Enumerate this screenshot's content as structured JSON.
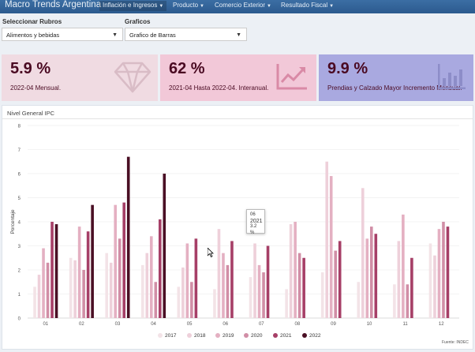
{
  "nav": {
    "brand": "Macro Trends Argentina",
    "items": [
      {
        "label": "Inflación e Ingresos"
      },
      {
        "label": "Producto"
      },
      {
        "label": "Comercio Exterior"
      },
      {
        "label": "Resultado Fiscal"
      }
    ]
  },
  "filters": {
    "rubros_label": "Seleccionar Rubros",
    "rubros_value": "Alimentos y bebidas",
    "graficos_label": "Graficos",
    "graficos_value": "Grafico de Barras"
  },
  "cards": [
    {
      "value": "5.9 %",
      "text": "2022-04 Mensual.",
      "icon": "diamond-icon",
      "bg": "#f0dbe2"
    },
    {
      "value": "62 %",
      "text": "2021-04 Hasta 2022-04. Interanual.",
      "icon": "trend-chart-icon",
      "bg": "#f2c8d8"
    },
    {
      "value": "9.9 %",
      "text": "Prendias y Calzado Mayor Incremento Mensual.",
      "icon": "bar-chart-icon",
      "bg": "#a9a9e0"
    }
  ],
  "panel": {
    "title": "Nivel General IPC",
    "source": "Fuente: INDEC"
  },
  "tooltip": {
    "line1": "06",
    "line2": "2021",
    "line3": "3.2 %"
  },
  "chart_data": {
    "type": "bar",
    "categories": [
      "01",
      "02",
      "03",
      "04",
      "05",
      "06",
      "07",
      "08",
      "09",
      "10",
      "11",
      "12"
    ],
    "ylabel": "Porcentaje",
    "ylim": [
      0,
      8
    ],
    "yticks": [
      "0",
      "1",
      "2",
      "3",
      "4",
      "5",
      "6",
      "7",
      "8"
    ],
    "series": [
      {
        "name": "2017",
        "color": "#f3e3e7",
        "values": [
          1.3,
          2.5,
          2.7,
          2.2,
          1.3,
          1.2,
          1.7,
          1.2,
          1.9,
          1.5,
          1.4,
          3.1
        ]
      },
      {
        "name": "2018",
        "color": "#eed0da",
        "values": [
          1.8,
          2.4,
          2.3,
          2.7,
          2.1,
          3.7,
          3.1,
          3.9,
          6.5,
          5.4,
          3.2,
          2.6
        ]
      },
      {
        "name": "2019",
        "color": "#e4b0c2",
        "values": [
          2.9,
          3.8,
          4.7,
          3.4,
          3.1,
          2.7,
          2.2,
          4.0,
          5.9,
          3.3,
          4.3,
          3.7
        ]
      },
      {
        "name": "2020",
        "color": "#d18ea6",
        "values": [
          2.3,
          2.0,
          3.3,
          1.5,
          1.5,
          2.2,
          1.9,
          2.7,
          2.8,
          3.8,
          1.4,
          4.0
        ]
      },
      {
        "name": "2021",
        "color": "#a63f67",
        "values": [
          4.0,
          3.6,
          4.8,
          4.1,
          3.3,
          3.2,
          3.0,
          2.5,
          3.2,
          3.5,
          2.5,
          3.8
        ]
      },
      {
        "name": "2022",
        "color": "#4a0f24",
        "values": [
          3.9,
          4.7,
          6.7,
          6.0,
          null,
          null,
          null,
          null,
          null,
          null,
          null,
          null
        ]
      }
    ],
    "legend": [
      "2017",
      "2018",
      "2019",
      "2020",
      "2021",
      "2022"
    ]
  }
}
